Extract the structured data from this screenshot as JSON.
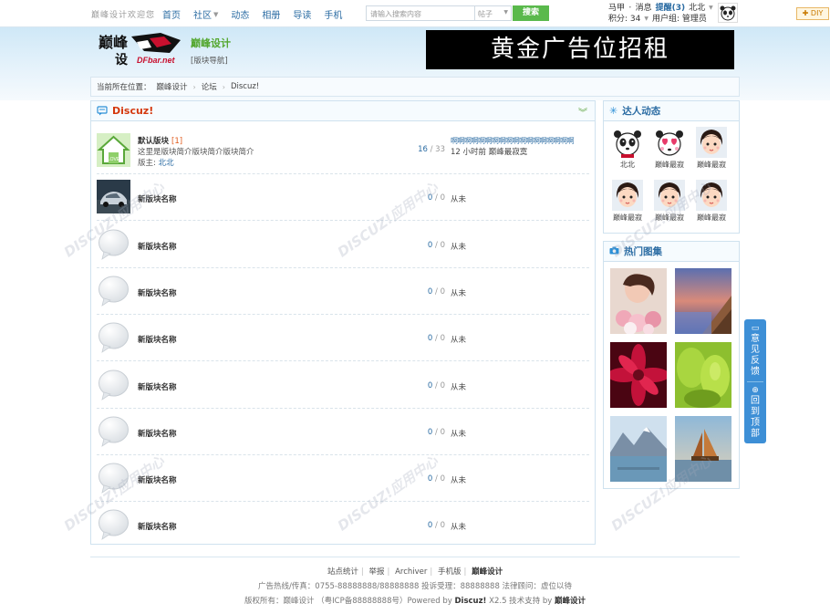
{
  "topbar": {
    "slogan": "巅峰设计欢迎您",
    "nav": [
      {
        "label": "首页",
        "has_caret": false
      },
      {
        "label": "社区",
        "has_caret": true
      },
      {
        "label": "动态",
        "has_caret": false
      },
      {
        "label": "相册",
        "has_caret": false
      },
      {
        "label": "导读",
        "has_caret": false
      },
      {
        "label": "手机",
        "has_caret": false
      }
    ],
    "search": {
      "placeholder": "请输入搜索内容",
      "type": "帖子",
      "button": "搜索"
    },
    "user": {
      "name": "马甲",
      "messages": "消息",
      "reminder": "提醒(3)",
      "username": "北北",
      "credits": "积分: 34",
      "usergroup": "用户组: 管理员"
    },
    "diy": "DIY"
  },
  "header": {
    "logo_text": "巅峰设计",
    "logo_sub": "DFbar.net",
    "site_name": "巅峰设计",
    "site_sub": "[版块导航]",
    "banner": "黄金广告位招租"
  },
  "breadcrumb": {
    "prefix": "当前所在位置：",
    "items": [
      "巅峰设计",
      "论坛",
      "Discuz!"
    ]
  },
  "main": {
    "title": "Discuz!",
    "forums": [
      {
        "name": "默认版块",
        "today": "[1]",
        "desc": "这里是版块简介版块简介版块简介",
        "mod_label": "版主:",
        "mod": "北北",
        "threads": "16",
        "posts": "33",
        "last_title": "啊啊啊啊啊啊啊啊啊啊啊啊啊啊啊啊啊啊",
        "last_info": "12 小时前 巅峰最寂寞",
        "icon": "house-icon"
      },
      {
        "name": "新版块名称",
        "threads": "0",
        "posts": "0",
        "last_info": "从未",
        "icon": "car-photo-icon"
      },
      {
        "name": "新版块名称",
        "threads": "0",
        "posts": "0",
        "last_info": "从未",
        "icon": "bubble-icon"
      },
      {
        "name": "新版块名称",
        "threads": "0",
        "posts": "0",
        "last_info": "从未",
        "icon": "bubble-icon"
      },
      {
        "name": "新版块名称",
        "threads": "0",
        "posts": "0",
        "last_info": "从未",
        "icon": "bubble-icon"
      },
      {
        "name": "新版块名称",
        "threads": "0",
        "posts": "0",
        "last_info": "从未",
        "icon": "bubble-icon"
      },
      {
        "name": "新版块名称",
        "threads": "0",
        "posts": "0",
        "last_info": "从未",
        "icon": "bubble-icon"
      },
      {
        "name": "新版块名称",
        "threads": "0",
        "posts": "0",
        "last_info": "从未",
        "icon": "bubble-icon"
      },
      {
        "name": "新版块名称",
        "threads": "0",
        "posts": "0",
        "last_info": "从未",
        "icon": "bubble-icon"
      }
    ]
  },
  "sidebar": {
    "members_title": "达人动态",
    "members": [
      {
        "name": "北北",
        "avatar": "panda-avatar"
      },
      {
        "name": "巅峰最寂",
        "avatar": "panda-love-avatar"
      },
      {
        "name": "巅峰最寂",
        "avatar": "cartoon-girl-avatar"
      },
      {
        "name": "巅峰最寂",
        "avatar": "cartoon-girl-avatar"
      },
      {
        "name": "巅峰最寂",
        "avatar": "cartoon-girl-avatar"
      },
      {
        "name": "巅峰最寂",
        "avatar": "cartoon-girl-avatar"
      }
    ],
    "photos_title": "热门图集"
  },
  "float_bar": {
    "feedback": "意见反馈",
    "top": "回到顶部"
  },
  "footer": {
    "links": [
      "站点统计",
      "举报",
      "Archiver",
      "手机版",
      "巅峰设计"
    ],
    "line2": "广告热线/传真：0755-88888888/88888888    投诉受理：88888888 法律顾问：虚位以待",
    "line3_a": "版权所有：巅峰设计  （粤ICP备88888888号）Powered by ",
    "line3_brand": "Discuz!",
    "line3_b": " X2.5  技术支持 by ",
    "line3_tech": "巅峰设计"
  },
  "colors": {
    "accent": "#2b6ca3",
    "brand_green": "#54a72f",
    "title_red": "#d4380d",
    "float_bar": "#3d8fd6"
  }
}
